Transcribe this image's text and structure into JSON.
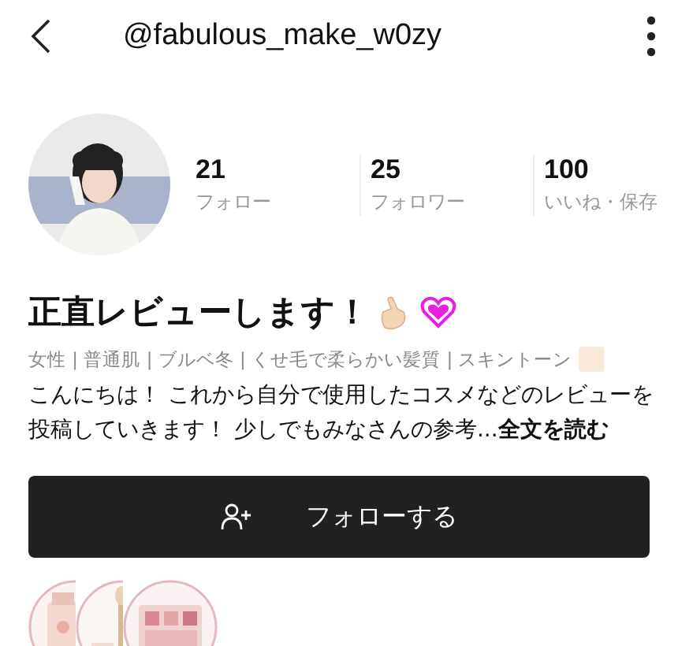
{
  "header": {
    "username": "@fabulous_make_w0zy"
  },
  "profile": {
    "stats": [
      {
        "count": "21",
        "label": "フォロー"
      },
      {
        "count": "25",
        "label": "フォロワー"
      },
      {
        "count": "100",
        "label": "いいね・保存"
      }
    ]
  },
  "title": "正直レビューします！",
  "tags": "女性 | 普通肌 | ブルベ冬 | くせ毛で柔らかい髪質 | スキントーン",
  "bio": {
    "text": "こんにちは！ これから自分で使用したコスメなどのレビューを投稿していきます！ 少しでもみなさんの参考...",
    "more_link": "全文を読む"
  },
  "follow_button": {
    "label": "フォローする"
  }
}
